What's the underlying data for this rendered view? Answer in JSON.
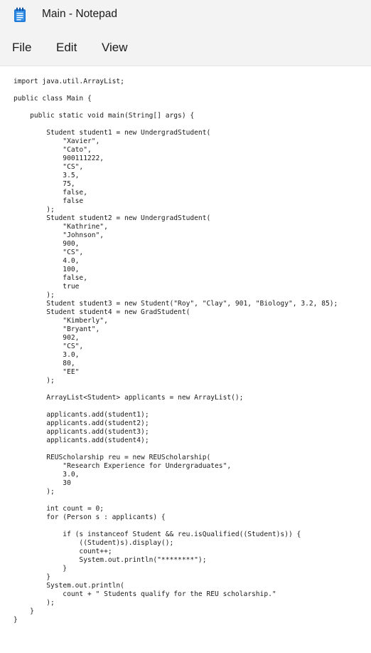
{
  "window": {
    "title": "Main - Notepad",
    "app_icon": "notepad-icon"
  },
  "menu": {
    "file_label": "File",
    "edit_label": "Edit",
    "view_label": "View"
  },
  "editor": {
    "content": "import java.util.ArrayList;\n\npublic class Main {\n\n    public static void main(String[] args) {\n\n        Student student1 = new UndergradStudent(\n            \"Xavier\",\n            \"Cato\",\n            900111222,\n            \"CS\",\n            3.5,\n            75,\n            false,\n            false\n        );\n        Student student2 = new UndergradStudent(\n            \"Kathrine\",\n            \"Johnson\",\n            900,\n            \"CS\",\n            4.0,\n            100,\n            false,\n            true\n        );\n        Student student3 = new Student(\"Roy\", \"Clay\", 901, \"Biology\", 3.2, 85);\n        Student student4 = new GradStudent(\n            \"Kimberly\",\n            \"Bryant\",\n            902,\n            \"CS\",\n            3.0,\n            80,\n            \"EE\"\n        );\n\n        ArrayList<Student> applicants = new ArrayList();\n\n        applicants.add(student1);\n        applicants.add(student2);\n        applicants.add(student3);\n        applicants.add(student4);\n\n        REUScholarship reu = new REUScholarship(\n            \"Research Experience for Undergraduates\",\n            3.0,\n            30\n        );\n\n        int count = 0;\n        for (Person s : applicants) {\n\n            if (s instanceof Student && reu.isQualified((Student)s)) {\n                ((Student)s).display();\n                count++;\n                System.out.println(\"********\");\n            }\n        }\n        System.out.println(\n            count + \" Students qualify for the REU scholarship.\"\n        );\n    }\n}"
  },
  "colors": {
    "titlebar_bg": "#f3f3f3",
    "editor_bg": "#ffffff",
    "text": "#1a1a1a",
    "icon_blue": "#1f7ad8"
  }
}
